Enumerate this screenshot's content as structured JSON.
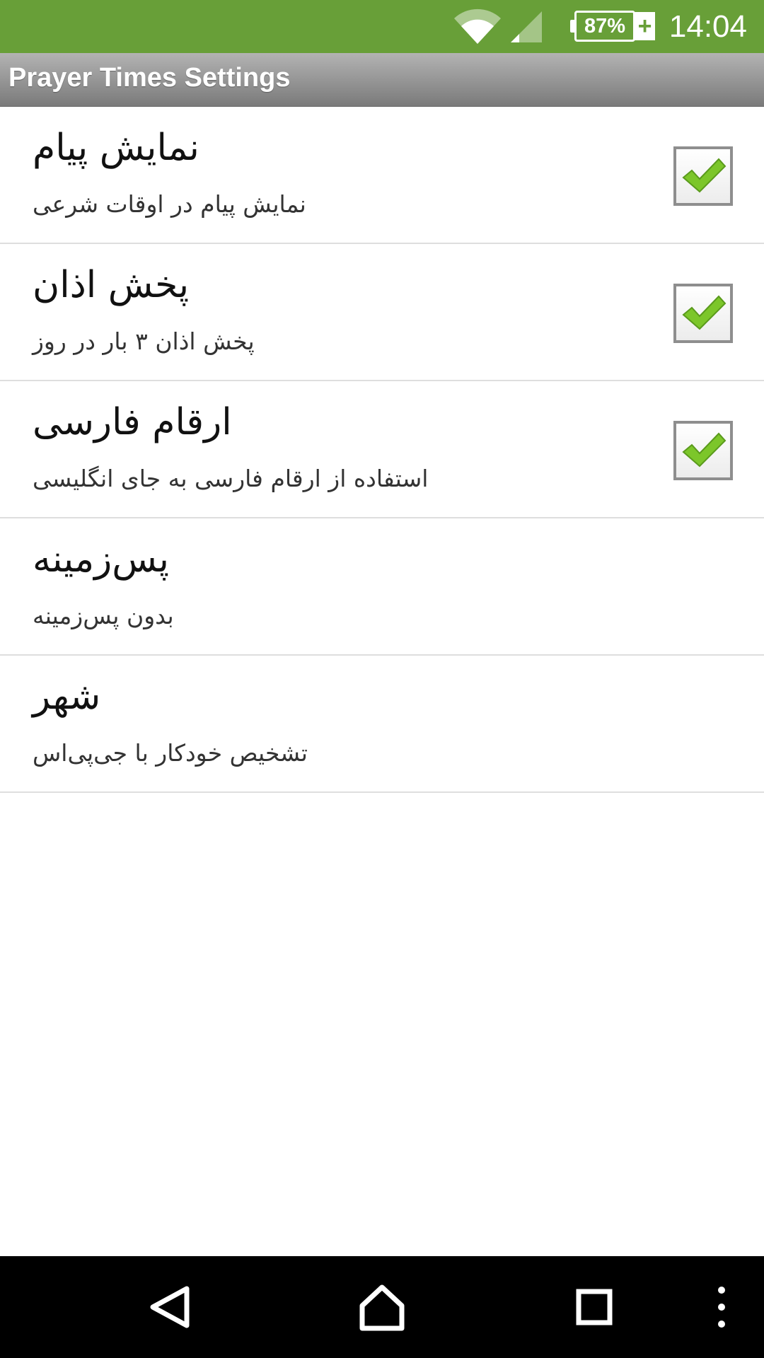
{
  "app": {
    "title": "Prayer Times Settings"
  },
  "status_bar": {
    "battery": "87%",
    "charging_symbol": "+",
    "time": "14:04",
    "icons": [
      "wifi-icon",
      "signal-icon",
      "battery-icon"
    ]
  },
  "settings": [
    {
      "title": "نمایش پیام",
      "summary": "نمایش پیام در اوقات شرعی",
      "has_checkbox": true,
      "checked": true
    },
    {
      "title": "پخش اذان",
      "summary": "پخش اذان ۳ بار در روز",
      "has_checkbox": true,
      "checked": true
    },
    {
      "title": "ارقام فارسی",
      "summary": "استفاده از ارقام فارسی به جای انگلیسی",
      "has_checkbox": true,
      "checked": true
    },
    {
      "title": "پس‌زمینه",
      "summary": "بدون پس‌زمینه",
      "has_checkbox": false
    },
    {
      "title": "شهر",
      "summary": "تشخیص خودکار با جی‌پی‌اس",
      "has_checkbox": false
    }
  ],
  "nav_bar": {
    "icons": [
      "back-icon",
      "home-icon",
      "recent-apps-icon",
      "overflow-menu-icon"
    ]
  },
  "colors": {
    "status_bar": "#689f38",
    "check_green": "#7cc62a",
    "divider": "#dedede"
  }
}
